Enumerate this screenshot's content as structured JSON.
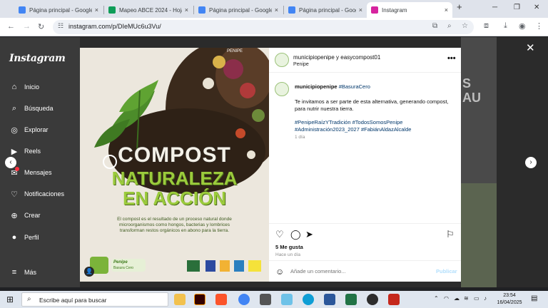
{
  "browser": {
    "tabs": [
      {
        "label": "Página principal - Google",
        "color": "#4285f4",
        "close": "×"
      },
      {
        "label": "Mapeo ABCE 2024 - Hoja",
        "color": "#0f9d58",
        "close": "×"
      },
      {
        "label": "Página principal - Google",
        "color": "#4285f4",
        "close": "×"
      },
      {
        "label": "Página principal - Google",
        "color": "#4285f4",
        "close": "×"
      },
      {
        "label": "Instagram",
        "color": "#d6249f",
        "close": "×"
      }
    ],
    "new_tab": "+",
    "url": "instagram.com/p/DIeMUc6u3Vu/"
  },
  "sidebar": {
    "logo": "Instagram",
    "items": [
      {
        "label": "Inicio",
        "icon": "⌂"
      },
      {
        "label": "Búsqueda",
        "icon": "⌕"
      },
      {
        "label": "Explorar",
        "icon": "◎"
      },
      {
        "label": "Reels",
        "icon": "▶"
      },
      {
        "label": "Mensajes",
        "icon": "✉"
      },
      {
        "label": "Notificaciones",
        "icon": "♡"
      },
      {
        "label": "Crear",
        "icon": "⊕"
      },
      {
        "label": "Perfil",
        "icon": "●"
      },
      {
        "label": "Más",
        "icon": "≡"
      }
    ]
  },
  "background": {
    "partial_text": "S\nAU"
  },
  "post": {
    "header_title": "municipiopenipe y easycompost01",
    "header_location": "Penipe",
    "caption_user": "municipiopenipe",
    "caption_tag": "#BasuraCero",
    "caption_line1": "Te invitamos a ser parte de esta alternativa, generando compost,",
    "caption_line2": "para nutrir nuestra tierra.",
    "hashtags_line1": "#PenipeRaízYTradición #TodosSomosPenipe",
    "hashtags_line2": "#Administración2023_2027 #FabiánAldazAlcalde",
    "caption_time": "1 día",
    "likes": "5 Me gusta",
    "like_date": "Hace un día",
    "comment_placeholder": "Añade un comentario...",
    "publish_label": "Publicar"
  },
  "image": {
    "title_line1": "COMPOST",
    "title_line2": "NATURALEZA",
    "title_line3": "EN ACCIÓN",
    "body_line1": "El compost es el resultado de un proceso natural donde",
    "body_line2": "microorganismos como hongos, bacterias y lombrices",
    "body_line3": "transforman restos orgánicos en abono para la tierra.",
    "logo_text": "Penipe",
    "logo_text2": "Basura Cero",
    "top_text": "PENIPE"
  },
  "taskbar": {
    "search_placeholder": "Escribe aquí para buscar",
    "time": "23:54",
    "date": "16/04/2025"
  }
}
